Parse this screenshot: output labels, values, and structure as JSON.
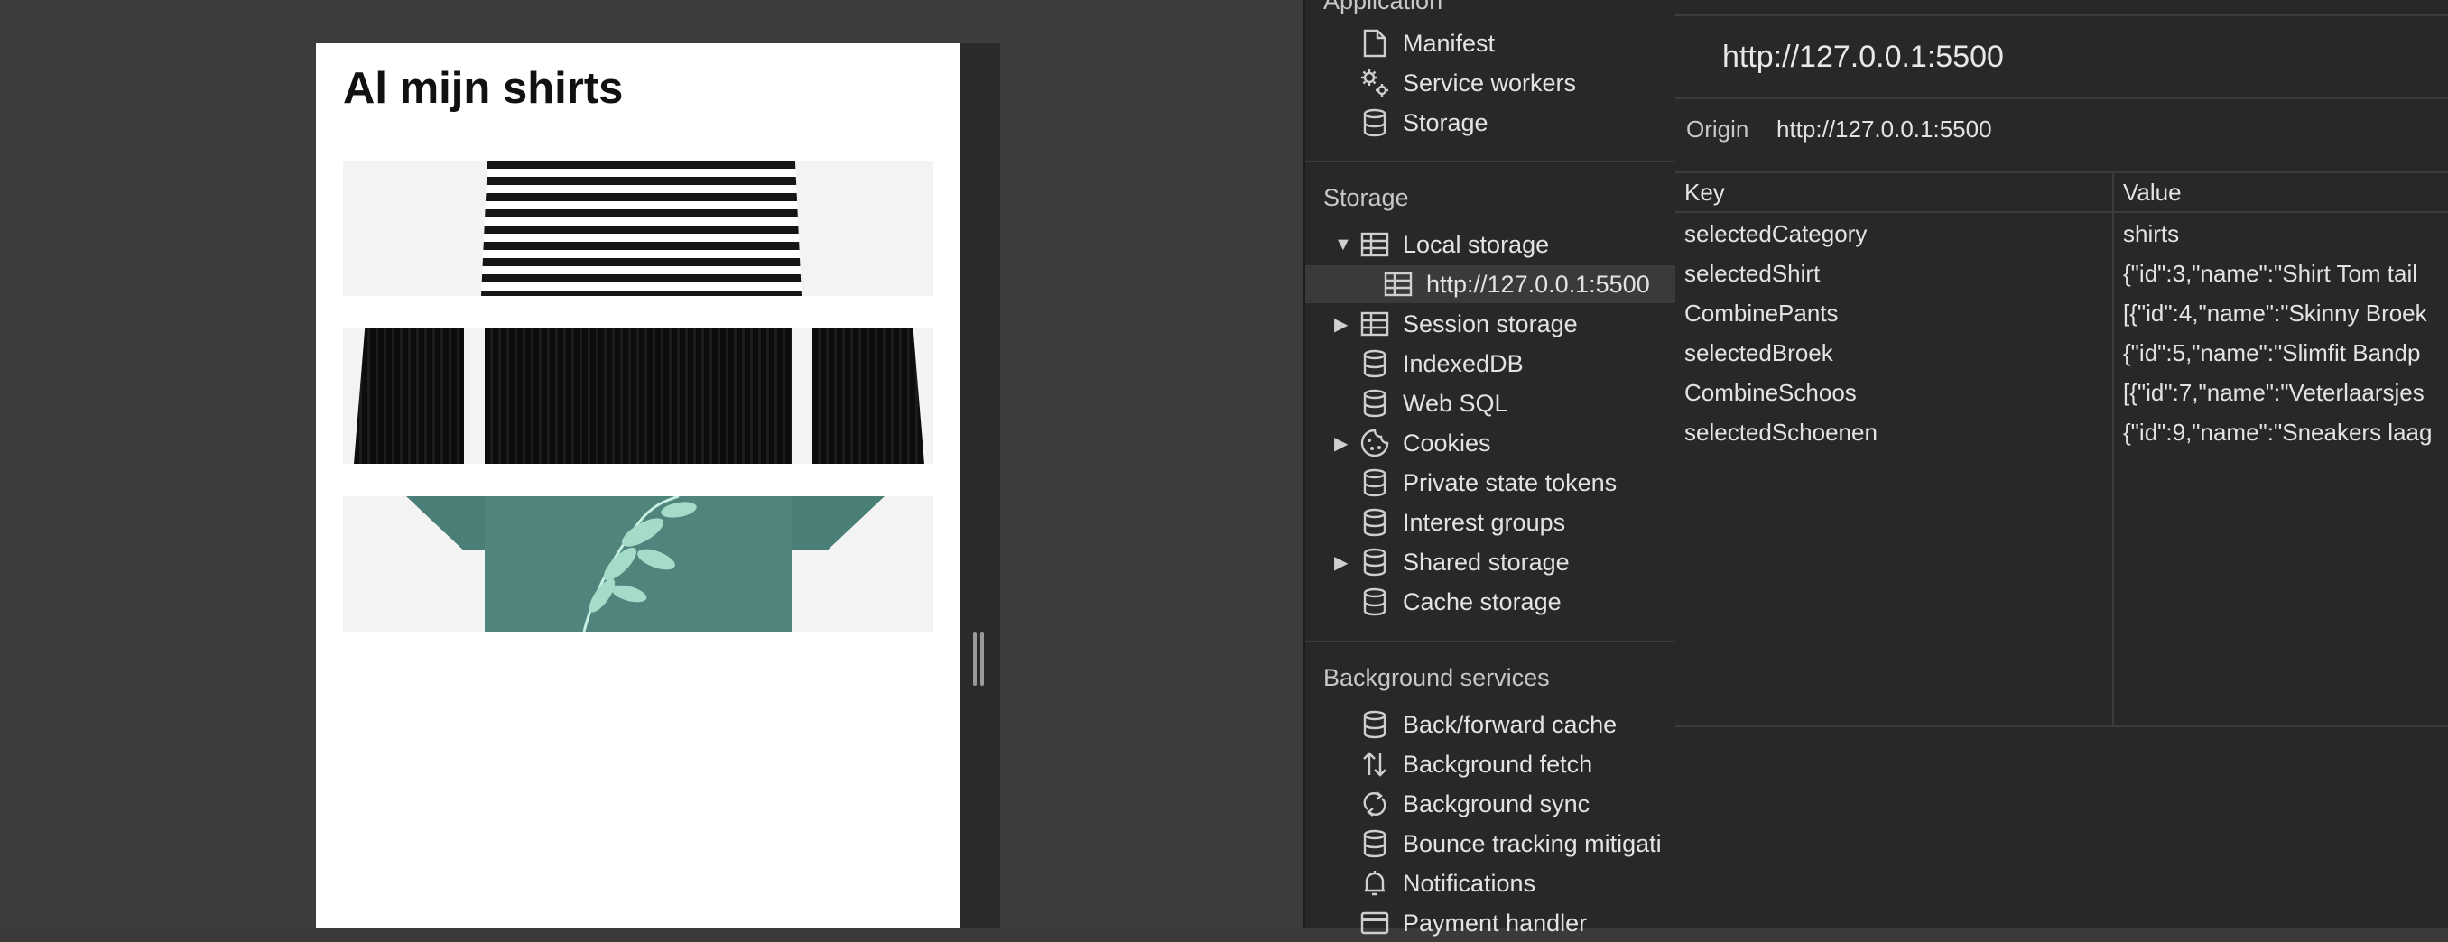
{
  "preview": {
    "page_title": "Al mijn shirts"
  },
  "sidebar": {
    "application_header": "Application",
    "application_items": [
      {
        "label": "Manifest",
        "icon": "document-icon"
      },
      {
        "label": "Service workers",
        "icon": "gears-icon"
      },
      {
        "label": "Storage",
        "icon": "database-icon"
      }
    ],
    "storage_header": "Storage",
    "storage_items": [
      {
        "label": "Local storage",
        "icon": "table-icon",
        "expanded": true
      },
      {
        "label": "http://127.0.0.1:5500",
        "icon": "table-icon",
        "selected": true
      },
      {
        "label": "Session storage",
        "icon": "table-icon",
        "expanded": false
      },
      {
        "label": "IndexedDB",
        "icon": "database-icon"
      },
      {
        "label": "Web SQL",
        "icon": "database-icon"
      },
      {
        "label": "Cookies",
        "icon": "cookie-icon",
        "expanded": false
      },
      {
        "label": "Private state tokens",
        "icon": "database-icon"
      },
      {
        "label": "Interest groups",
        "icon": "database-icon"
      },
      {
        "label": "Shared storage",
        "icon": "database-icon",
        "expanded": false
      },
      {
        "label": "Cache storage",
        "icon": "database-icon"
      }
    ],
    "background_header": "Background services",
    "background_items": [
      {
        "label": "Back/forward cache",
        "icon": "database-icon"
      },
      {
        "label": "Background fetch",
        "icon": "up-down-arrows-icon"
      },
      {
        "label": "Background sync",
        "icon": "sync-icon"
      },
      {
        "label": "Bounce tracking mitigati",
        "icon": "database-icon"
      },
      {
        "label": "Notifications",
        "icon": "bell-icon"
      },
      {
        "label": "Payment handler",
        "icon": "card-icon"
      }
    ]
  },
  "main": {
    "url_heading": "http://127.0.0.1:5500",
    "origin_label": "Origin",
    "origin_value": "http://127.0.0.1:5500",
    "columns": [
      "Key",
      "Value"
    ],
    "rows": [
      {
        "key": "selectedCategory",
        "value": "shirts"
      },
      {
        "key": "selectedShirt",
        "value": "{\"id\":3,\"name\":\"Shirt Tom tail"
      },
      {
        "key": "CombinePants",
        "value": "[{\"id\":4,\"name\":\"Skinny Broek"
      },
      {
        "key": "selectedBroek",
        "value": "{\"id\":5,\"name\":\"Slimfit Bandp"
      },
      {
        "key": "CombineSchoos",
        "value": "[{\"id\":7,\"name\":\"Veterlaarsjes"
      },
      {
        "key": "selectedSchoenen",
        "value": "{\"id\":9,\"name\":\"Sneakers laag"
      }
    ]
  }
}
